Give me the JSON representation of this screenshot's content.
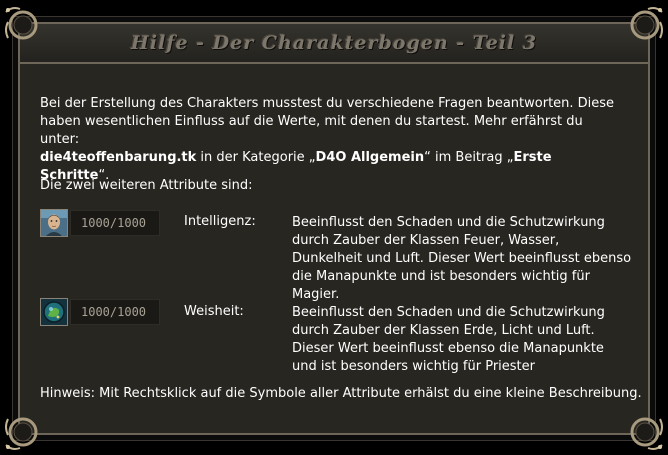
{
  "window": {
    "title": "Hilfe - Der Charakterbogen - Teil 3"
  },
  "intro": {
    "line1": "Bei der Erstellung des Charakters musstest du verschiedene Fragen beantworten. Diese",
    "line2": "haben wesentlichen Einfluss auf die Werte, mit denen du startest. Mehr erfährst du unter:",
    "link": "die4teoffenbarung.tk",
    "mid1": " in der Kategorie „",
    "category": "D4O Allgemein",
    "mid2": "“ im Beitrag „",
    "post": "Erste Schritte",
    "end": "“."
  },
  "subheading": "Die zwei weiteren Attribute sind:",
  "attributes": [
    {
      "icon": "face-portrait-icon",
      "value": "1000/1000",
      "name": "Intelligenz:",
      "description": "Beeinflusst den Schaden und die Schutzwirkung durch Zauber der Klassen Feuer, Wasser, Dunkelheit und Luft. Dieser Wert beeinflusst ebenso die Manapunkte und ist besonders wichtig für Magier."
    },
    {
      "icon": "wisdom-orb-icon",
      "value": "1000/1000",
      "name": "Weisheit:",
      "description": "Beeinflusst den Schaden und die Schutzwirkung durch Zauber der Klassen Erde, Licht und Luft. Dieser Wert beeinflusst ebenso die Manapunkte und ist besonders wichtig für Priester"
    }
  ],
  "hint": "Hinweis: Mit Rechtsklick auf die Symbole aller Attribute erhälst du eine kleine Beschreibung.",
  "colors": {
    "background": "#282621",
    "border": "#6e6659",
    "title": "#7d766b",
    "text": "#ffffff"
  }
}
